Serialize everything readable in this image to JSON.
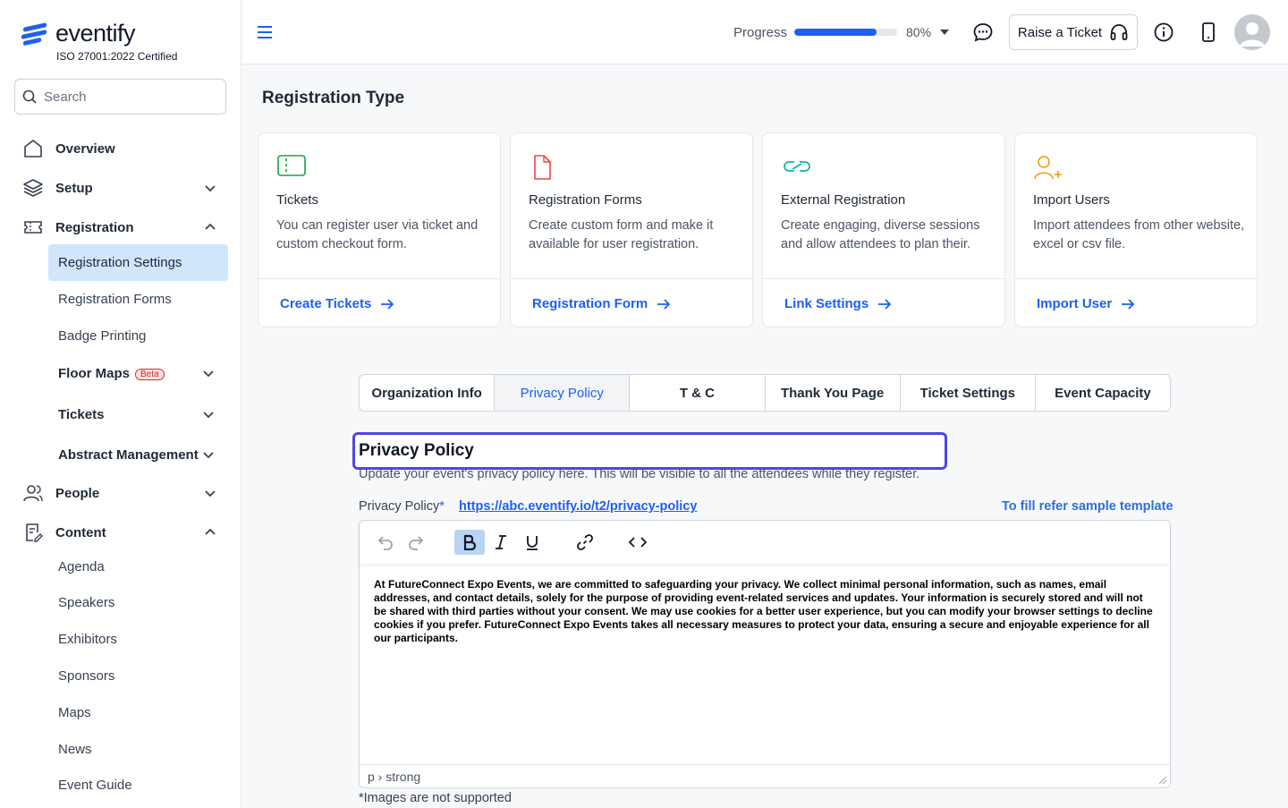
{
  "brand": {
    "name": "eventify",
    "certification": "ISO 27001:2022 Certified",
    "accent": "#1d5ff5"
  },
  "search": {
    "placeholder": "Search"
  },
  "sidebar": {
    "overview": "Overview",
    "setup": "Setup",
    "registration": "Registration",
    "registration_sub": [
      "Registration Settings",
      "Registration Forms",
      "Badge Printing"
    ],
    "floor_maps": "Floor Maps",
    "beta": "Beta",
    "tickets": "Tickets",
    "abstract": "Abstract Management",
    "people": "People",
    "content": "Content",
    "content_sub": [
      "Agenda",
      "Speakers",
      "Exhibitors",
      "Sponsors",
      "Maps",
      "News",
      "Event Guide"
    ]
  },
  "topbar": {
    "progress_label": "Progress",
    "progress_value": 80,
    "progress_text": "80%",
    "raise_ticket": "Raise a Ticket"
  },
  "main": {
    "title": "Registration Type",
    "cards": [
      {
        "title": "Tickets",
        "desc": "You can register user via ticket and custom checkout form.",
        "link": "Create Tickets",
        "icon": "ticket-icon",
        "color": "#16a34a"
      },
      {
        "title": "Registration Forms",
        "desc": "Create custom form and make it available for user registration.",
        "link": "Registration Form",
        "icon": "document-icon",
        "color": "#ef4444"
      },
      {
        "title": "External Registration",
        "desc": "Create engaging, diverse sessions and allow attendees to plan their.",
        "link": "Link Settings",
        "icon": "link-icon",
        "color": "#14b8a6"
      },
      {
        "title": "Import Users",
        "desc": "Import attendees from other website, excel or csv file.",
        "link": "Import User",
        "icon": "user-plus-icon",
        "color": "#f59e0b"
      }
    ],
    "tabs": [
      "Organization Info",
      "Privacy Policy",
      "T & C",
      "Thank You Page",
      "Ticket Settings",
      "Event Capacity"
    ],
    "active_tab": "Privacy Policy"
  },
  "privacy": {
    "heading": "Privacy Policy",
    "subtext": "Update your event's privacy policy here. This will be visible to all the attendees while they register.",
    "label": "Privacy Policy",
    "required": "*",
    "url": "https://abc.eventify.io/t2/privacy-policy",
    "template_link": "To fill refer sample template",
    "body": "At FutureConnect Expo Events, we are committed to safeguarding your privacy. We collect minimal personal information, such as names, email addresses, and contact details, solely for the purpose of providing event-related services and updates. Your information is securely stored and will not be shared with third parties without your consent. We may use cookies for a better user experience, but you can modify your browser settings to decline cookies if you prefer. FutureConnect Expo Events takes all necessary measures to protect your data, ensuring a secure and enjoyable experience for all our participants.",
    "path": "p › strong",
    "note": "*Images are not supported"
  }
}
